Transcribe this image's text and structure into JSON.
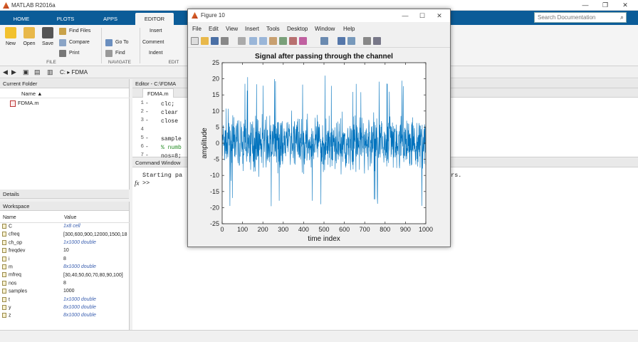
{
  "window": {
    "title": "MATLAB R2016a",
    "minimize": "—",
    "maximize": "❐",
    "close": "✕"
  },
  "ribbon_tabs": [
    "HOME",
    "PLOTS",
    "APPS",
    "EDITOR"
  ],
  "search": {
    "placeholder": "Search Documentation"
  },
  "ribbon": {
    "new": "New",
    "open": "Open",
    "save": "Save",
    "find_files": "Find Files",
    "compare": "Compare",
    "print": "Print",
    "insert": "Insert",
    "comment": "Comment",
    "indent": "Indent",
    "go_to": "Go To",
    "find": "Find",
    "group_file": "FILE",
    "group_navigate": "NAVIGATE",
    "group_edit": "EDIT"
  },
  "address": {
    "path_root": "C:",
    "path_folder": "FDMA"
  },
  "current_folder": {
    "title": "Current Folder",
    "column": "Name",
    "files": [
      "FDMA.m"
    ]
  },
  "details": {
    "title": "Details"
  },
  "workspace": {
    "title": "Workspace",
    "col_name": "Name",
    "col_value": "Value",
    "rows": [
      {
        "name": "C",
        "value": "1x8 cell",
        "italic": true
      },
      {
        "name": "cfreq",
        "value": "[300,600,900,12000,1500,18",
        "italic": false
      },
      {
        "name": "ch_op",
        "value": "1x1000 double",
        "italic": true
      },
      {
        "name": "freqdev",
        "value": "10",
        "italic": false
      },
      {
        "name": "i",
        "value": "8",
        "italic": false
      },
      {
        "name": "m",
        "value": "8x1000 double",
        "italic": true
      },
      {
        "name": "mfreq",
        "value": "[30,40,50,60,70,80,90,100]",
        "italic": false
      },
      {
        "name": "nos",
        "value": "8",
        "italic": false
      },
      {
        "name": "samples",
        "value": "1000",
        "italic": false
      },
      {
        "name": "t",
        "value": "1x1000 double",
        "italic": true
      },
      {
        "name": "y",
        "value": "8x1000 double",
        "italic": true
      },
      {
        "name": "z",
        "value": "8x1000 double",
        "italic": true
      }
    ]
  },
  "editor": {
    "title": "Editor - C:\\FDMA",
    "tab": "FDMA.m",
    "lines": [
      {
        "n": "1",
        "text": "clc;"
      },
      {
        "n": "2",
        "text": "clear"
      },
      {
        "n": "3",
        "text": "close"
      },
      {
        "n": "4",
        "text": ""
      },
      {
        "n": "5",
        "text": "sample"
      },
      {
        "n": "6",
        "text": "% numb"
      },
      {
        "n": "7",
        "text": "nos=8;"
      }
    ]
  },
  "command_window": {
    "title": "Command Window",
    "line1": "Starting pa",
    "line1_end": "ers.",
    "prompt": ">>"
  },
  "figure": {
    "title": "Figure 10",
    "menu": [
      "File",
      "Edit",
      "View",
      "Insert",
      "Tools",
      "Desktop",
      "Window",
      "Help"
    ]
  },
  "chart_data": {
    "type": "line",
    "title": "Signal after passing through the channel",
    "xlabel": "time index",
    "ylabel": "amplitude",
    "xlim": [
      0,
      1000
    ],
    "ylim": [
      -25,
      25
    ],
    "xticks": [
      0,
      100,
      200,
      300,
      400,
      500,
      600,
      700,
      800,
      900,
      1000
    ],
    "yticks": [
      -25,
      -20,
      -15,
      -10,
      -5,
      0,
      5,
      10,
      15,
      20,
      25
    ],
    "line_color": "#0072bd",
    "series": [
      {
        "x_start": 1,
        "x_end": 1000,
        "samples": 1000,
        "range_min": -22,
        "range_max": 21,
        "typical_amplitude": 8
      }
    ]
  }
}
